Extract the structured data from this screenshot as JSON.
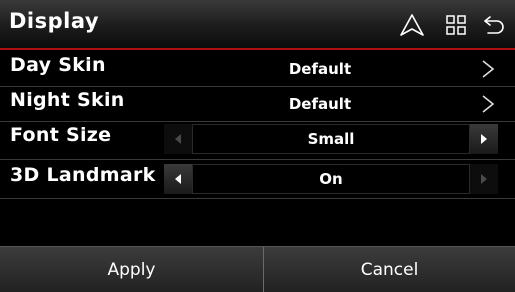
{
  "header": {
    "title": "Display",
    "icons": [
      "navigation-icon",
      "grid-menu-icon",
      "back-icon"
    ]
  },
  "rows": [
    {
      "label": "Day Skin",
      "value": "Default",
      "control": "chevron"
    },
    {
      "label": "Night Skin",
      "value": "Default",
      "control": "chevron"
    },
    {
      "label": "Font Size",
      "value": "Small",
      "control": "stepper",
      "left_enabled": false,
      "right_enabled": true
    },
    {
      "label": "3D Landmark",
      "value": "On",
      "control": "stepper",
      "left_enabled": true,
      "right_enabled": false
    }
  ],
  "footer": {
    "apply_label": "Apply",
    "cancel_label": "Cancel"
  },
  "colors": {
    "accent_line": "#b01010",
    "background": "#000000",
    "text": "#ffffff"
  }
}
